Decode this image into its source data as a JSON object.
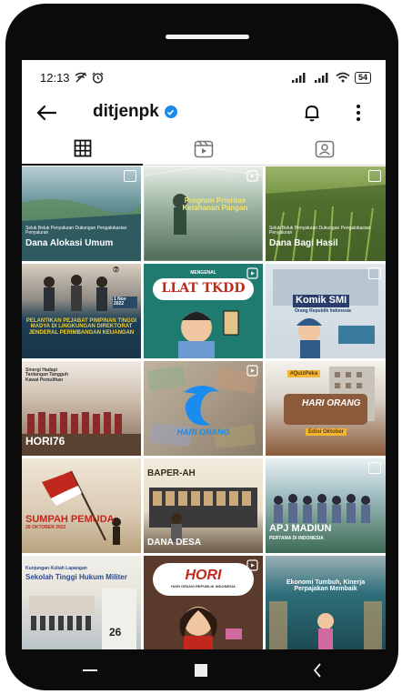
{
  "status_bar": {
    "time": "12:13",
    "battery": "54"
  },
  "header": {
    "username": "ditjenpk"
  },
  "icons": {
    "back": "arrow-left-icon",
    "verified": "verified-badge-icon",
    "bell": "bell-icon",
    "more": "more-vertical-icon",
    "grid_tab": "grid-icon",
    "reels_tab": "reels-icon",
    "tagged_tab": "tagged-person-icon"
  },
  "posts": [
    {
      "caption": "Dana Alokasi Umum",
      "sub": "Seluk Beluk Penyaluran Dukungan Pengalokasian Penyaluran",
      "bg": "#3b6a72",
      "accent": "#f2b632"
    },
    {
      "caption": "Program Prioritas Ketahanan Pangan",
      "sub": "",
      "bg": "#4f6b56",
      "accent": "#f2b632"
    },
    {
      "caption": "Dana Bagi Hasil",
      "sub": "Seluk Beluk Penyaluran Dukungan Pengalokasian Penyaluran",
      "bg": "#4d6a2e",
      "accent": "#f2b632"
    },
    {
      "caption": "PELANTIKAN PEJABAT PIMPINAN TINGGI MADYA DI LINGKUNGAN DIREKTORAT JENDERAL PERIMBANGAN KEUANGAN",
      "sub": "1 Nov 2022",
      "bg": "#1d3f56",
      "accent": "#f2d036"
    },
    {
      "caption": "LLAT TKDD",
      "sub": "MENGENAL",
      "bg": "#1f7a6f",
      "accent": "#ffffff"
    },
    {
      "caption": "Komik SMI",
      "sub": "Orang Republik Indonesia",
      "bg": "#cfd8df",
      "accent": "#1f3e6e"
    },
    {
      "caption": "HORI76",
      "sub": "Sinergi Hadapi Tantangan Tangguh Kawal Pemulihan",
      "bg": "#c9b8a6",
      "accent": "#ffffff"
    },
    {
      "caption": "HARI ORANG",
      "sub": "",
      "bg": "#a89a86",
      "accent": "#1a8cf0"
    },
    {
      "caption": "HARI ORANG",
      "sub": "Edisi Oktober",
      "bg": "#8a5a3a",
      "accent": "#f2b632"
    },
    {
      "caption": "SUMPAH PEMUDA",
      "sub": "28 OKTOBER 2022",
      "bg": "#d9c9b2",
      "accent": "#b4261e"
    },
    {
      "caption": "DANA DESA",
      "sub": "BAPER-AH",
      "bg": "#e7ddc8",
      "accent": "#8a5a2a"
    },
    {
      "caption": "APJ MADIUN",
      "sub": "PERTAMA DI INDONESIA",
      "bg": "#3c6a54",
      "accent": "#f2b632"
    },
    {
      "caption": "Sekolah Tinggi Hukum Militer",
      "sub": "Kunjungan Kuliah Lapangan",
      "bg": "#e7e4dc",
      "accent": "#2f4a8a"
    },
    {
      "caption": "HORI",
      "sub": "HARI ORANG REPUBLIK INDONESIA",
      "bg": "#5a3a2a",
      "accent": "#c0281e"
    },
    {
      "caption": "Ekonomi Tumbuh, Kinerja Perpajakan Membaik",
      "sub": "",
      "bg": "#2e6e7a",
      "accent": "#ffffff"
    }
  ]
}
